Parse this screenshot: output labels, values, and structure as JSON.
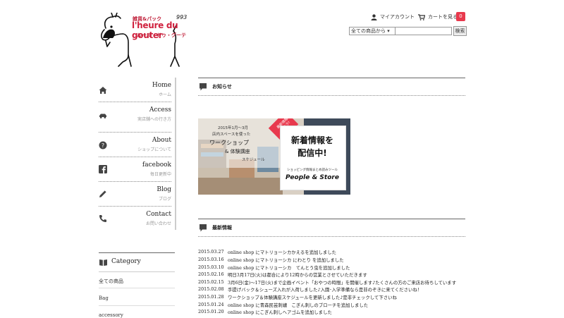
{
  "logo": {
    "line1": "雑貨&パック",
    "line2": "l'heure du gouter",
    "line3": "ルール・ドゥ・グーテ",
    "number": "993"
  },
  "header": {
    "my_account": "マイアカウント",
    "view_cart": "カートを見る",
    "cart_count": "0"
  },
  "search": {
    "category_selected": "全ての商品から",
    "button": "検索"
  },
  "nav": {
    "items": [
      {
        "title": "Home",
        "sub": "ホーム",
        "icon": "home-icon"
      },
      {
        "title": "Access",
        "sub": "実店舗への行き方",
        "icon": "car-icon"
      },
      {
        "title": "About",
        "sub": "ショップについて",
        "icon": "question-icon"
      },
      {
        "title": "facebook",
        "sub": "毎日更新中",
        "icon": "facebook-icon"
      },
      {
        "title": "Blog",
        "sub": "ブログ",
        "icon": "pencil-icon"
      },
      {
        "title": "Contact",
        "sub": "お問い合わせ",
        "icon": "phone-icon"
      }
    ]
  },
  "category": {
    "title": "Category",
    "items": [
      "全ての商品",
      "Bag",
      "accessory"
    ]
  },
  "sections": {
    "notice_title": "お知らせ",
    "news_title": "最新情報"
  },
  "banner": {
    "left_line1": "2015年1月〜3月",
    "left_line2": "店内スペースを使った",
    "left_line3": "ワークショップ",
    "left_line4": "& 体験講座",
    "left_line5": "スケジュール",
    "badge_line1": "最新情報",
    "badge_line2": "コチラ!",
    "right_line1": "新着情報を",
    "right_line2": "配信中!",
    "right_small": "ショッピング情報まとめ読みツール",
    "right_brand": "People & Store"
  },
  "news": [
    {
      "date": "2015.03.27",
      "text": "online shop にマトリョーシカかえるを追加しました"
    },
    {
      "date": "2015.03.16",
      "text": "online shop にマトリョーシカ にわとり を追加しました"
    },
    {
      "date": "2015.03.10",
      "text": "online shop にマトリョーシカ　てんとう虫を追加しました"
    },
    {
      "date": "2015.02.16",
      "text": "明日3月17日(火)は都合により12時からの営業とさせていただきます"
    },
    {
      "date": "2015.02.15",
      "text": "3月6日(金)〜17日(火)まで企画イベント「おやつの時間」を開催します♪たくさんの方のご来店お待ちしています"
    },
    {
      "date": "2015.02.08",
      "text": "手提げバック＆シューズ入れが入荷しました♪入園･入学準備なら是非のぞきに来てくださいね！"
    },
    {
      "date": "2015.01.28",
      "text": "ワークショップ＆体験講座スケジュールを更新しました♪是非チェックして下さいね"
    },
    {
      "date": "2015.01.24",
      "text": "online shop に青森民芸刺繍　こぎん刺しのブローチを追加しました"
    },
    {
      "date": "2015.01.20",
      "text": "online shop にこぎん刺しヘアゴムを追加しました"
    }
  ],
  "colors": {
    "accent": "#e8394d",
    "logo_red": "#d0213e"
  }
}
